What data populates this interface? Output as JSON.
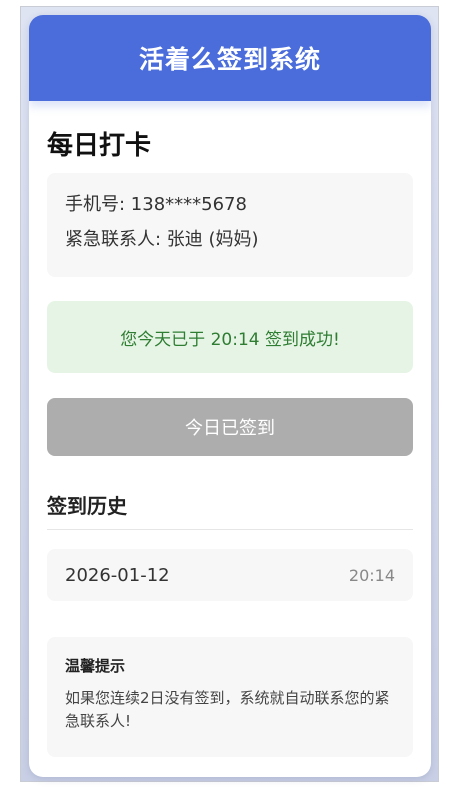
{
  "app": {
    "title": "活着么签到系统"
  },
  "checkin": {
    "section_title": "每日打卡",
    "phone_label": "手机号: 138****5678",
    "contact_label": "紧急联系人: 张迪 (妈妈)",
    "status_message": "您今天已于 20:14 签到成功!",
    "button_label": "今日已签到"
  },
  "history": {
    "title": "签到历史",
    "items": [
      {
        "date": "2026-01-12",
        "time": "20:14"
      }
    ]
  },
  "tip": {
    "title": "温馨提示",
    "text": "如果您连续2日没有签到，系统就自动联系您的紧急联系人!"
  },
  "colors": {
    "header_bg": "#4a6ddb",
    "success_bg": "#e6f4e5",
    "success_text": "#2e7d32",
    "button_disabled": "#adadad"
  }
}
